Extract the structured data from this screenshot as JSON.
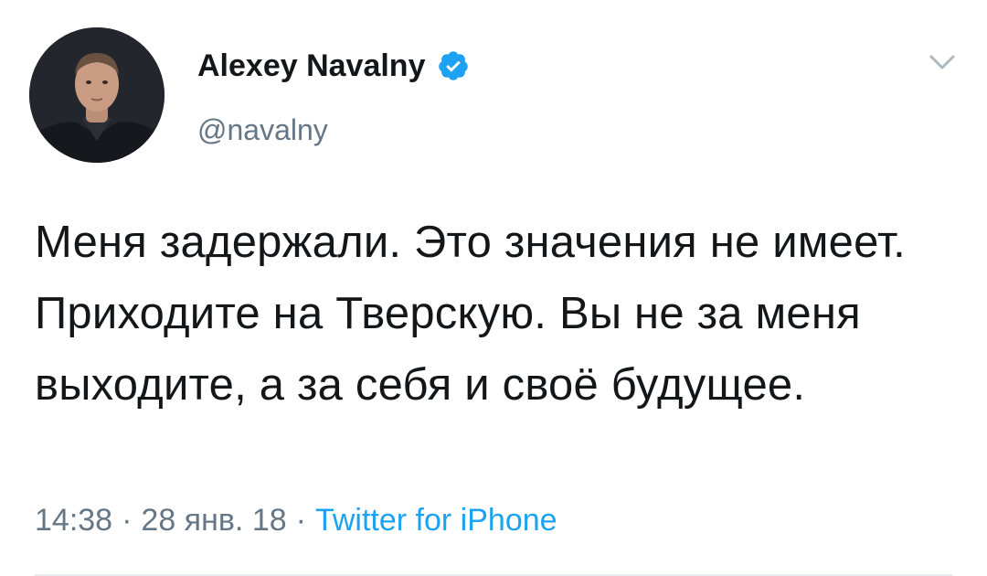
{
  "tweet": {
    "author": {
      "display_name": "Alexey Navalny",
      "handle": "@navalny",
      "verified_icon": "verified-badge-icon",
      "avatar_icon": "avatar"
    },
    "menu_icon": "chevron-down-icon",
    "text": "Меня задержали. Это значения не имеет. Приходите на Тверскую. Вы не за меня выходите, а за себя и своё будущее.",
    "time": "14:38",
    "date": "28 янв. 18",
    "separator": "·",
    "source": "Twitter for iPhone"
  },
  "colors": {
    "text": "#14171a",
    "secondary": "#657786",
    "link": "#1da1f2",
    "verified": "#1da1f2",
    "divider": "#e6ecf0"
  }
}
